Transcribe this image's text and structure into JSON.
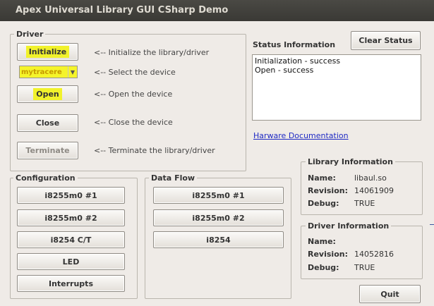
{
  "window": {
    "title": "Apex Universal Library GUI CSharp Demo"
  },
  "driver": {
    "legend": "Driver",
    "initialize_label": "Initialize",
    "initialize_desc": "<-- Initialize the library/driver",
    "device_value": "mytracere",
    "device_desc": "<-- Select the device",
    "open_label": "Open",
    "open_desc": "<-- Open the device",
    "close_label": "Close",
    "close_desc": "<-- Close the device",
    "terminate_label": "Terminate",
    "terminate_desc": "<-- Terminate the library/driver"
  },
  "status": {
    "label": "Status Information",
    "clear_label": "Clear Status",
    "lines": [
      "Initialization - success",
      "Open - success"
    ],
    "doc_link": "Harware Documentation"
  },
  "library_info": {
    "legend": "Library Information",
    "name_label": "Name:",
    "name_value": "libaul.so",
    "revision_label": "Revision:",
    "revision_value": "14061909",
    "debug_label": "Debug:",
    "debug_value": "TRUE"
  },
  "driver_info": {
    "legend": "Driver Information",
    "name_label": "Name:",
    "name_value": "",
    "revision_label": "Revision:",
    "revision_value": "14052816",
    "debug_label": "Debug:",
    "debug_value": "TRUE"
  },
  "configuration": {
    "legend": "Configuration",
    "buttons": [
      "i8255m0 #1",
      "i8255m0 #2",
      "i8254 C/T",
      "LED",
      "Interrupts"
    ]
  },
  "data_flow": {
    "legend": "Data Flow",
    "buttons": [
      "i8255m0 #1",
      "i8255m0 #2",
      "i8254"
    ]
  },
  "quit_label": "Quit"
}
